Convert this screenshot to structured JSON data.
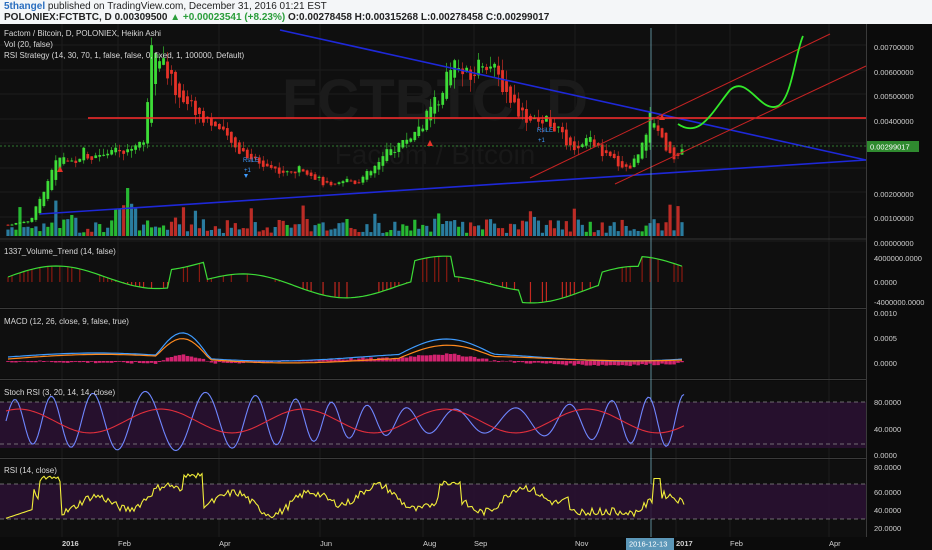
{
  "header": {
    "user": "5thangel",
    "published": "published on TradingView.com, December 31, 2016 01:21 EST",
    "symbol_line": "POLONIEX:FCTBTC, D",
    "price": "0.00309500",
    "change": "▲ +0.00023541 (+8.23%)",
    "ohlc": "O:0.00278458 H:0.00315268 L:0.00278458 C:0.00299017"
  },
  "watermark": {
    "big": "FCTBTC, D",
    "small": "Factom / Bitcoin"
  },
  "legend": {
    "main_title": "Factom / Bitcoin, D, POLONIEX, Heikin Ashi",
    "vol": "Vol (20, false)",
    "rsi_strategy": "RSI Strategy (14, 30, 70, 1, false, false, 0, fixed, 1, 100000, Default)",
    "volume_trend": "1337_Volume_Trend (14, false)",
    "macd": "MACD (12, 26, close, 9, false, true)",
    "stoch": "Stoch RSI (3, 20, 14, 14, close)",
    "rsi": "RSI (14, close)"
  },
  "price_axis": {
    "ticks": [
      "0.00700000",
      "0.00600000",
      "0.00500000",
      "0.00400000",
      "0.00300000",
      "0.00200000",
      "0.00100000",
      "0.00000000"
    ],
    "last_price": "0.00299017"
  },
  "volume_trend_axis": {
    "ticks": [
      "4000000.0000",
      "0.0000",
      "-4000000.0000"
    ]
  },
  "macd_axis": {
    "ticks": [
      "0.0010",
      "0.0005",
      "0.0000"
    ]
  },
  "stoch_axis": {
    "ticks": [
      "80.0000",
      "40.0000",
      "0.0000"
    ]
  },
  "rsi_axis": {
    "ticks": [
      "80.0000",
      "60.0000",
      "40.0000",
      "20.0000"
    ]
  },
  "time_axis": {
    "labels": [
      "2016",
      "Feb",
      "Apr",
      "Jun",
      "Aug",
      "Sep",
      "Nov",
      "2017",
      "Feb",
      "Apr"
    ],
    "highlight": "2016-12-13"
  },
  "signals": {
    "long": "RsiLE",
    "qty": "+1"
  },
  "colors": {
    "up": "#3ddc37",
    "down": "#e63228",
    "macd_line": "#3f9cff",
    "signal_line": "#ff8a1e",
    "stoch_k": "#6f86ff",
    "stoch_d": "#e12f3c",
    "rsi": "#f2ee3a",
    "trend": "#1e28d8",
    "resistance": "#ff2b2b",
    "projection": "#33e82a"
  },
  "chart_data": [
    {
      "type": "candlestick",
      "title": "Factom / Bitcoin, D, POLONIEX, Heikin Ashi",
      "ylim": [
        0,
        0.0075
      ],
      "x_labels": [
        "2016",
        "Feb",
        "Apr",
        "Jun",
        "Aug",
        "Sep",
        "Nov",
        "2017",
        "Feb",
        "Apr"
      ],
      "close_path": [
        [
          0.0004,
          0.00045,
          0.0005,
          0.00055
        ],
        [
          0.0012,
          0.0018,
          0.0025,
          0.0028,
          0.0026,
          0.0027,
          0.003,
          0.0028,
          0.0029,
          0.0031,
          0.003,
          0.0029,
          0.003,
          0.0034,
          0.0032
        ],
        [
          0.0072,
          0.0065,
          0.0058,
          0.0052,
          0.0049,
          0.0047,
          0.0044,
          0.0042,
          0.004,
          0.0037
        ],
        [
          0.0034,
          0.0031,
          0.003,
          0.0028,
          0.0026,
          0.0025,
          0.0024,
          0.0023,
          0.0022,
          0.0023,
          0.0024,
          0.0022,
          0.002,
          0.0018
        ],
        [
          0.0017,
          0.0019,
          0.002,
          0.0019,
          0.0021,
          0.0023,
          0.0026,
          0.0029,
          0.0031,
          0.0033,
          0.0035,
          0.0037
        ],
        [
          0.0041,
          0.0045,
          0.005,
          0.0057,
          0.0062,
          0.0058,
          0.0055,
          0.006,
          0.0063,
          0.0059,
          0.0055,
          0.005,
          0.0046
        ],
        [
          0.0043,
          0.0041,
          0.004,
          0.0042,
          0.0039,
          0.0036,
          0.0031,
          0.0029,
          0.0032,
          0.0035,
          0.003,
          0.0028,
          0.0027,
          0.0025,
          0.0024
        ],
        [
          0.0028,
          0.0036,
          0.0043,
          0.0037,
          0.0031,
          0.0027,
          0.00299
        ]
      ],
      "series": [
        {
          "name": "Vol",
          "type": "bar"
        },
        {
          "name": "1337_Volume_Trend",
          "range": [
            -4000000,
            4000000
          ]
        },
        {
          "name": "MACD",
          "range": [
            0,
            0.001
          ]
        },
        {
          "name": "Stoch RSI",
          "range": [
            0,
            100
          ],
          "bands": [
            20,
            80
          ]
        },
        {
          "name": "RSI",
          "range": [
            0,
            100
          ],
          "bands": [
            30,
            70
          ]
        }
      ]
    }
  ]
}
